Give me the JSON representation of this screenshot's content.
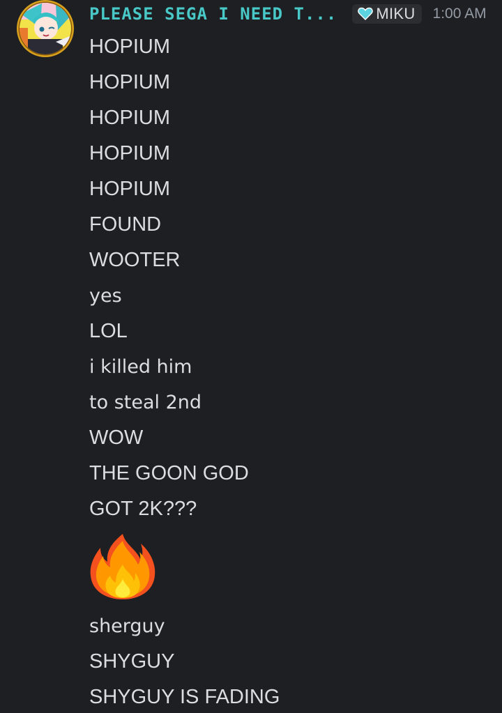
{
  "message": {
    "author": "PLEASE SEGA I NEED T...",
    "role_tag": {
      "label": "MIKU",
      "icon": "heart-icon",
      "color": "#5dd3e0"
    },
    "timestamp": "1:00 AM",
    "username_color": "#49c8c8",
    "avatar": "avatar-miku"
  },
  "lines": [
    "HOPIUM",
    "HOPIUM",
    "HOPIUM",
    "HOPIUM",
    "HOPIUM",
    "FOUND",
    "WOOTER",
    "yes",
    "LOL",
    "i killed him",
    "to steal 2nd",
    "WOW",
    "THE GOON GOD",
    "GOT 2K???"
  ],
  "emoji": "fire-emoji",
  "lines_after": [
    "sherguy",
    "SHYGUY",
    "SHYGUY IS FADING"
  ]
}
